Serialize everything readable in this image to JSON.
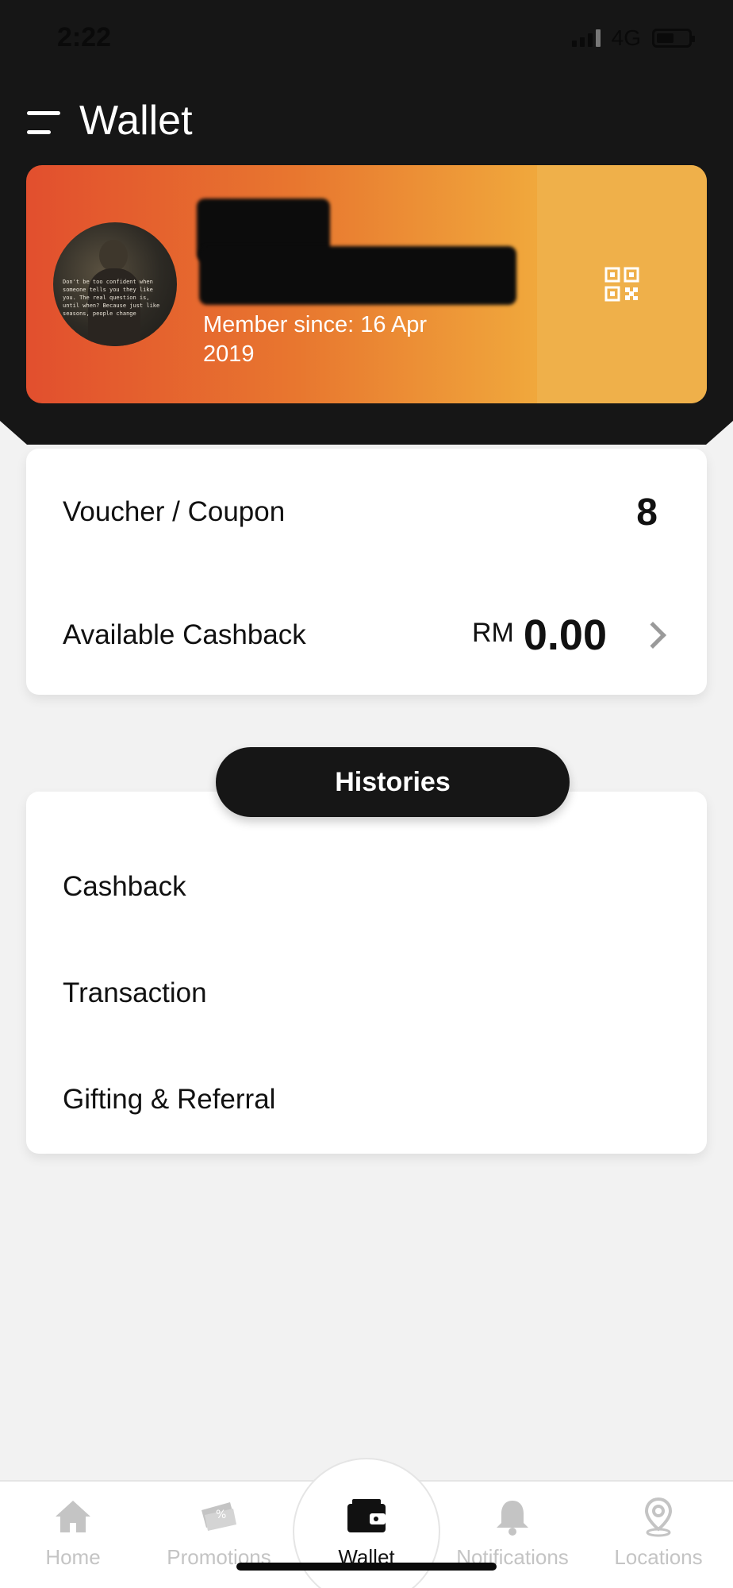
{
  "status_bar": {
    "time": "2:22",
    "network": "4G"
  },
  "header": {
    "title": "Wallet",
    "menu_icon": "hamburger-menu-icon"
  },
  "member_card": {
    "member_since_label": "Member since:",
    "member_since_date": "16 Apr 2019",
    "avatar_quote": "Don't be too confident when someone tells you they like you. The real question is, until when? Because just like seasons, people change",
    "qr_icon": "qr-code-icon",
    "gradient_start": "#e24f2e",
    "gradient_end": "#f0b048"
  },
  "summary": {
    "voucher_label": "Voucher / Coupon",
    "voucher_count": "8",
    "cashback_label": "Available Cashback",
    "cashback_currency": "RM",
    "cashback_amount": "0.00"
  },
  "histories": {
    "title": "Histories",
    "items": [
      {
        "label": "Cashback"
      },
      {
        "label": "Transaction"
      },
      {
        "label": "Gifting & Referral"
      }
    ]
  },
  "bottom_nav": {
    "items": [
      {
        "label": "Home",
        "icon": "home-icon",
        "active": false
      },
      {
        "label": "Promotions",
        "icon": "promotions-icon",
        "active": false
      },
      {
        "label": "Wallet",
        "icon": "wallet-icon",
        "active": true
      },
      {
        "label": "Notifications",
        "icon": "bell-icon",
        "active": false
      },
      {
        "label": "Locations",
        "icon": "location-pin-icon",
        "active": false
      }
    ]
  },
  "colors": {
    "header_bg": "#161616",
    "page_bg": "#f2f2f2",
    "inactive_nav": "#c4c4c4"
  }
}
